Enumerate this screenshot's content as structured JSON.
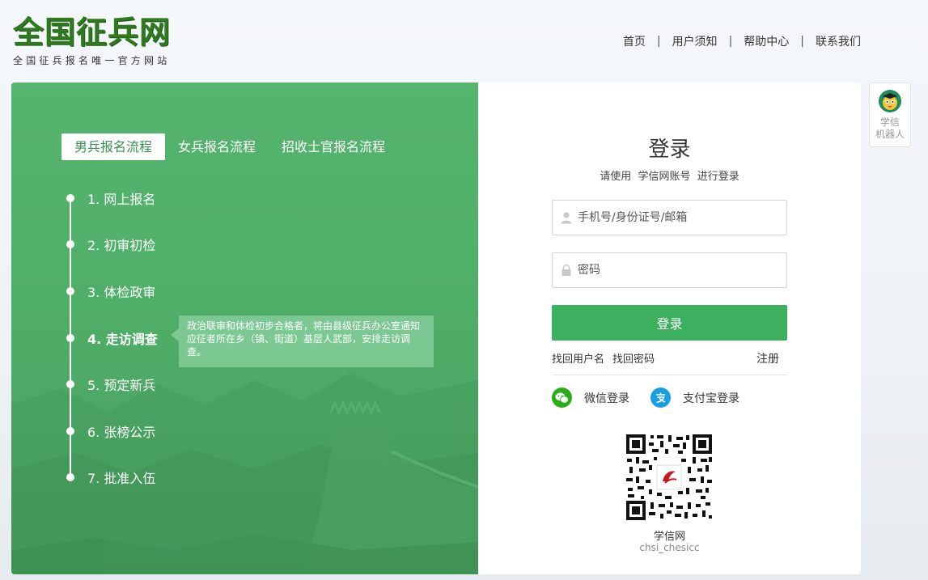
{
  "header": {
    "logo_title": "全国征兵网",
    "logo_subtitle": "全国征兵报名唯一官方网站",
    "nav": [
      "首页",
      "用户须知",
      "帮助中心",
      "联系我们"
    ],
    "nav_separator": "|"
  },
  "left_panel": {
    "tabs": [
      {
        "label": "男兵报名流程",
        "active": true
      },
      {
        "label": "女兵报名流程",
        "active": false
      },
      {
        "label": "招收士官报名流程",
        "active": false
      }
    ],
    "steps": [
      {
        "label": "1. 网上报名",
        "active": false
      },
      {
        "label": "2. 初审初检",
        "active": false
      },
      {
        "label": "3. 体检政审",
        "active": false
      },
      {
        "label": "4. 走访调查",
        "active": true
      },
      {
        "label": "5. 预定新兵",
        "active": false
      },
      {
        "label": "6. 张榜公示",
        "active": false
      },
      {
        "label": "7. 批准入伍",
        "active": false
      }
    ],
    "tooltip": "政治联审和体检初步合格者，将由县级征兵办公室通知应征者所在乡（镇、街道）基层人武部，安排走访调查。"
  },
  "login": {
    "title": "登录",
    "subtitle": "请使用  学信网账号  进行登录",
    "username_placeholder": "手机号/身份证号/邮箱",
    "password_placeholder": "密码",
    "submit_label": "登录",
    "find_username": "找回用户名",
    "find_password": "找回密码",
    "register": "注册",
    "wechat_login": "微信登录",
    "alipay_login": "支付宝登录",
    "qr_title": "学信网",
    "qr_account": "chsi_chesicc"
  },
  "robot": {
    "line1": "学信",
    "line2": "机器人"
  },
  "colors": {
    "brand_green": "#3cb05e",
    "panel_green": "#52b26c",
    "logo_green": "#2f7a1f",
    "wechat": "#2aae15",
    "alipay": "#1a9fe4"
  }
}
